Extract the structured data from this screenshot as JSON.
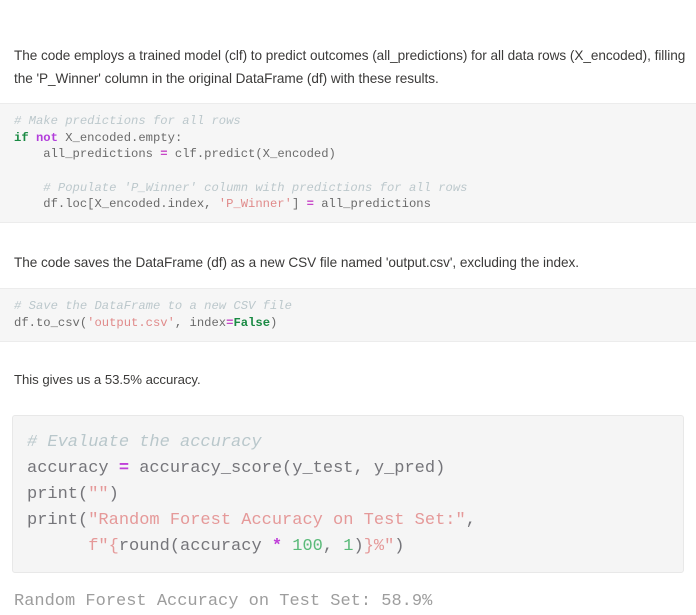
{
  "paragraphs": {
    "p1": "The code employs a trained model (clf) to predict outcomes (all_predictions) for all data rows (X_encoded), filling the 'P_Winner' column in the original DataFrame (df) with these results.",
    "p2": "The code saves the DataFrame (df) as a new CSV file named 'output.csv', excluding the index.",
    "p3": "This gives us a 53.5% accuracy."
  },
  "code_block_1": {
    "language": "python",
    "lines": [
      {
        "tokens": [
          {
            "t": "# Make predictions for all rows",
            "c": "comment"
          }
        ]
      },
      {
        "tokens": [
          {
            "t": "if",
            "c": "kw"
          },
          {
            "t": " ",
            "c": "plain"
          },
          {
            "t": "not",
            "c": "kw2"
          },
          {
            "t": " X_encoded.empty:",
            "c": "plain"
          }
        ]
      },
      {
        "tokens": [
          {
            "t": "    all_predictions ",
            "c": "plain"
          },
          {
            "t": "=",
            "c": "op"
          },
          {
            "t": " clf.predict(X_encoded)",
            "c": "plain"
          }
        ]
      },
      {
        "tokens": [
          {
            "t": "",
            "c": "plain"
          }
        ]
      },
      {
        "tokens": [
          {
            "t": "    # Populate 'P_Winner' column with predictions for all rows",
            "c": "comment"
          }
        ]
      },
      {
        "tokens": [
          {
            "t": "    df.loc[X_encoded.index, ",
            "c": "plain"
          },
          {
            "t": "'P_Winner'",
            "c": "str"
          },
          {
            "t": "] ",
            "c": "plain"
          },
          {
            "t": "=",
            "c": "op"
          },
          {
            "t": " all_predictions",
            "c": "plain"
          }
        ]
      }
    ]
  },
  "code_block_2": {
    "language": "python",
    "lines": [
      {
        "tokens": [
          {
            "t": "# Save the DataFrame to a new CSV file",
            "c": "comment"
          }
        ]
      },
      {
        "tokens": [
          {
            "t": "df.to_csv(",
            "c": "plain"
          },
          {
            "t": "'output.csv'",
            "c": "str"
          },
          {
            "t": ", index",
            "c": "plain"
          },
          {
            "t": "=",
            "c": "op"
          },
          {
            "t": "False",
            "c": "kw"
          },
          {
            "t": ")",
            "c": "plain"
          }
        ]
      }
    ]
  },
  "code_block_3": {
    "language": "python",
    "lines": [
      {
        "tokens": [
          {
            "t": "# Evaluate the accuracy",
            "c": "comment-lg"
          }
        ]
      },
      {
        "tokens": [
          {
            "t": "accuracy ",
            "c": "plain-lg"
          },
          {
            "t": "=",
            "c": "op-lg"
          },
          {
            "t": " accuracy_score(y_test, y_pred)",
            "c": "plain-lg"
          }
        ]
      },
      {
        "tokens": [
          {
            "t": "print(",
            "c": "plain-lg"
          },
          {
            "t": "\"\"",
            "c": "str-lg"
          },
          {
            "t": ")",
            "c": "plain-lg"
          }
        ]
      },
      {
        "tokens": [
          {
            "t": "print(",
            "c": "plain-lg"
          },
          {
            "t": "\"Random Forest Accuracy on Test Set:\"",
            "c": "str-lg"
          },
          {
            "t": ",",
            "c": "plain-lg"
          }
        ]
      },
      {
        "tokens": [
          {
            "t": "      ",
            "c": "plain-lg"
          },
          {
            "t": "f\"{",
            "c": "str-lg"
          },
          {
            "t": "round(accuracy ",
            "c": "plain-lg"
          },
          {
            "t": "*",
            "c": "op-lg"
          },
          {
            "t": " ",
            "c": "plain-lg"
          },
          {
            "t": "100",
            "c": "num"
          },
          {
            "t": ", ",
            "c": "plain-lg"
          },
          {
            "t": "1",
            "c": "num"
          },
          {
            "t": ")",
            "c": "plain-lg"
          },
          {
            "t": "}%\"",
            "c": "str-lg"
          },
          {
            "t": ")",
            "c": "plain-lg"
          }
        ]
      }
    ]
  },
  "program_output": {
    "text": "Random Forest Accuracy on Test Set: 58.9%",
    "label": "random-forest-accuracy-result",
    "accuracy_value": "58.9%"
  },
  "colors": {
    "page_background": "#ffffff",
    "prose_text": "#3b3a39",
    "code_background_small": "#f6f6f6",
    "code_background_large": "#f5f5f5",
    "code_border": "#e8e8e8",
    "token_comment": "#bcc8cc",
    "token_keyword": "#1a8a43",
    "token_keyword_alt": "#b23ddb",
    "token_operator": "#c746c7",
    "token_string": "#e08a8a",
    "token_number": "#5aba79",
    "token_plain": "#6b6b6b",
    "output_text": "#9d9d9d"
  }
}
